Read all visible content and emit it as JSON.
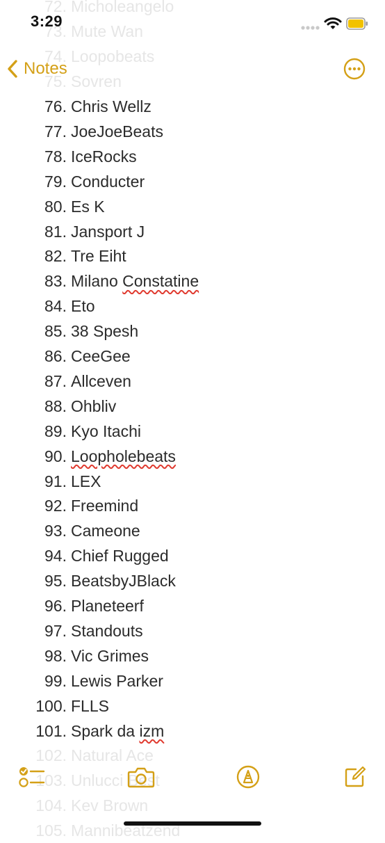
{
  "status_bar": {
    "time": "3:29"
  },
  "nav": {
    "back_label": "Notes"
  },
  "faded_rows_top": [
    {
      "number": "72.",
      "name": "Micholeangelo"
    },
    {
      "number": "73.",
      "name": "Mute Wan"
    },
    {
      "number": "74.",
      "name": "Loopobeats"
    },
    {
      "number": "75.",
      "name": "Sovren"
    }
  ],
  "rows": [
    {
      "number": "76.",
      "name": "Chris Wellz"
    },
    {
      "number": "77.",
      "name": "JoeJoeBeats"
    },
    {
      "number": "78.",
      "name": "IceRocks"
    },
    {
      "number": "79.",
      "name": "Conducter"
    },
    {
      "number": "80.",
      "name": "Es K"
    },
    {
      "number": "81.",
      "name": "Jansport J"
    },
    {
      "number": "82.",
      "name": "Tre Eiht"
    },
    {
      "number": "83.",
      "name": "Milano ",
      "misspelled": "Constatine"
    },
    {
      "number": "84.",
      "name": "Eto"
    },
    {
      "number": "85.",
      "name": "38 Spesh"
    },
    {
      "number": "86.",
      "name": "CeeGee"
    },
    {
      "number": "87.",
      "name": "Allceven"
    },
    {
      "number": "88.",
      "name": "Ohbliv"
    },
    {
      "number": "89.",
      "name": "Kyo Itachi"
    },
    {
      "number": "90.",
      "name": "",
      "misspelled": "Loopholebeats"
    },
    {
      "number": "91.",
      "name": "LEX"
    },
    {
      "number": "92.",
      "name": "Freemind"
    },
    {
      "number": "93.",
      "name": "Cameone"
    },
    {
      "number": "94.",
      "name": "Chief Rugged"
    },
    {
      "number": "95.",
      "name": "BeatsbyJBlack"
    },
    {
      "number": "96.",
      "name": "Planeteerf"
    },
    {
      "number": "97.",
      "name": "Standouts"
    },
    {
      "number": "98.",
      "name": "Vic Grimes"
    },
    {
      "number": "99.",
      "name": "Lewis Parker"
    },
    {
      "number": "100.",
      "name": "FLLS"
    },
    {
      "number": "101.",
      "name": "Spark da ",
      "misspelled": "izm"
    }
  ],
  "faded_rows_bottom": [
    {
      "number": "102.",
      "name": "Natural Ace"
    },
    {
      "number": "103.",
      "name": "Unlucci Best"
    },
    {
      "number": "104.",
      "name": "Kev Brown"
    },
    {
      "number": "105.",
      "name": "Mannibeatzend"
    }
  ],
  "colors": {
    "accent": "#d4a017",
    "misspell": "#e03a2f",
    "text": "#2b2b2b",
    "faded": "#e6e6e6"
  },
  "toolbar": {
    "icons": [
      "checklist-icon",
      "camera-icon",
      "markup-pen-icon",
      "compose-icon"
    ]
  }
}
